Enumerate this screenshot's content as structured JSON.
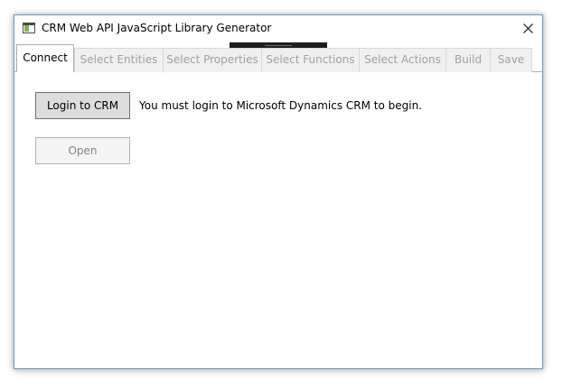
{
  "window": {
    "title": "CRM Web API JavaScript Library Generator",
    "icon": "app-window-icon",
    "close_icon": "close-icon"
  },
  "tabs": [
    {
      "label": "Connect",
      "active": true,
      "enabled": true
    },
    {
      "label": "Select Entities",
      "active": false,
      "enabled": false
    },
    {
      "label": "Select Properties",
      "active": false,
      "enabled": false
    },
    {
      "label": "Select Functions",
      "active": false,
      "enabled": false
    },
    {
      "label": "Select Actions",
      "active": false,
      "enabled": false
    },
    {
      "label": "Build",
      "active": false,
      "enabled": false
    },
    {
      "label": "Save",
      "active": false,
      "enabled": false
    }
  ],
  "connect": {
    "login_button": "Login to CRM",
    "login_message": "You must login to Microsoft Dynamics CRM to begin.",
    "open_button": "Open",
    "open_enabled": false
  },
  "colors": {
    "window_border": "#6f96c4",
    "button_face": "#dddddd",
    "disabled_text": "#a0a0a0"
  }
}
